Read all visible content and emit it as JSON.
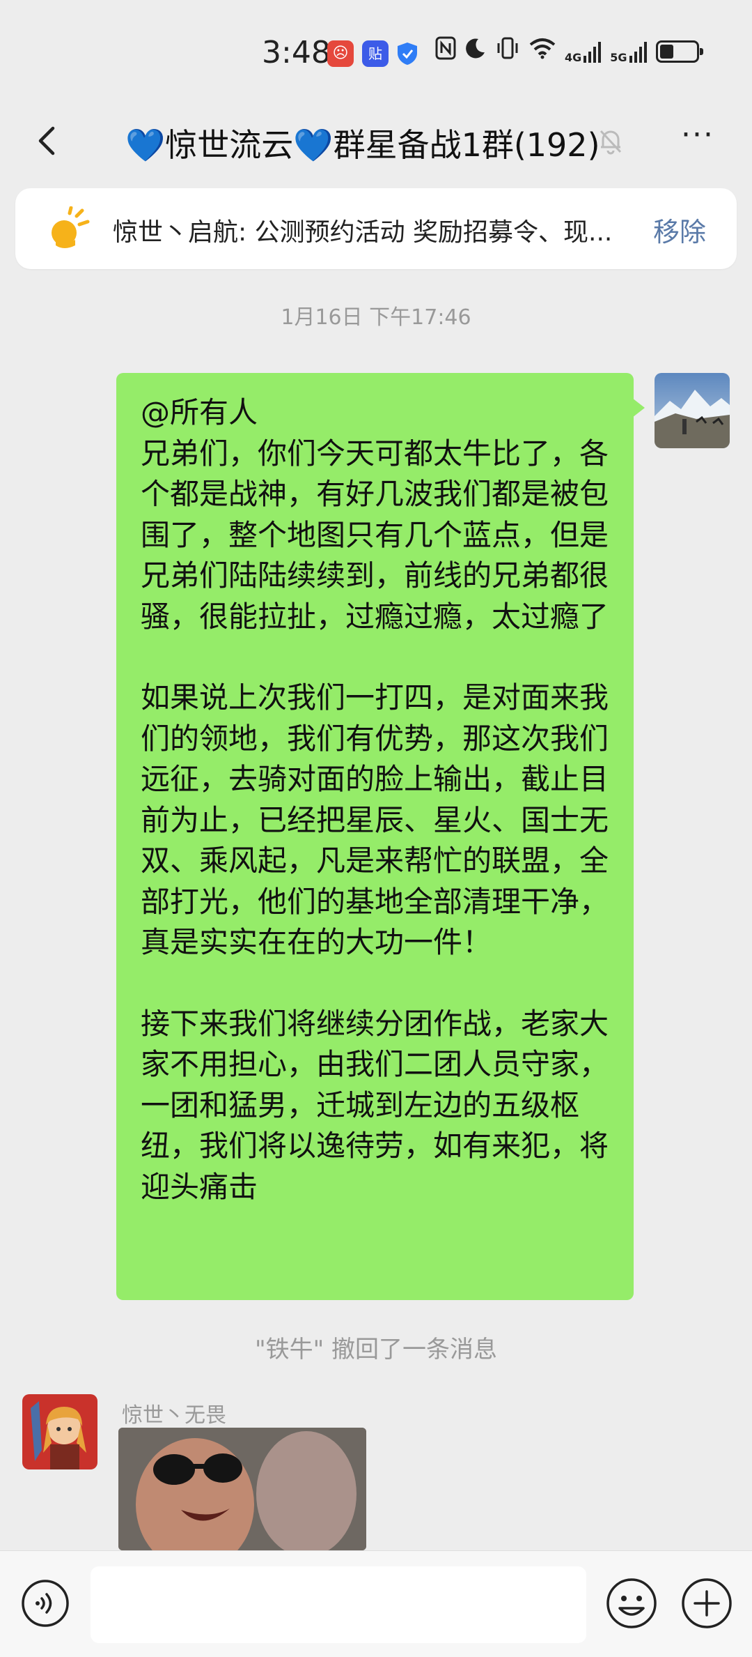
{
  "status_bar": {
    "time": "3:48",
    "app_badges": [
      "app-red-icon",
      "贴",
      "shield-icon"
    ],
    "network_4g": "4G",
    "network_5g": "5G"
  },
  "header": {
    "heart": "💙",
    "title_part1": "惊世流云",
    "title_part2": "群星备战1群(192)",
    "more": "···"
  },
  "pinned": {
    "text": "惊世丶启航: 公测预约活动 奖励招募令、现...",
    "remove_label": "移除"
  },
  "chat": {
    "timestamp": "1月16日 下午17:46",
    "my_message": {
      "p1": "@所有人\n兄弟们，你们今天可都太牛比了，各个都是战神，有好几波我们都是被包围了，整个地图只有几个蓝点，但是兄弟们陆陆续续到，前线的兄弟都很骚，很能拉扯，过瘾过瘾，太过瘾了",
      "p2": "如果说上次我们一打四，是对面来我们的领地，我们有优势，那这次我们远征，去骑对面的脸上输出，截止目前为止，已经把星辰、星火、国士无双、乘风起，凡是来帮忙的联盟，全部打光，他们的基地全部清理干净，真是实实在在的大功一件！",
      "p3": "接下来我们将继续分团作战，老家大家不用担心，由我们二团人员守家，一团和猛男，迁城到左边的五级枢纽，我们将以逸待劳，如有来犯，将迎头痛击"
    },
    "recall_notice": "\"铁牛\" 撤回了一条消息",
    "other_sender": "惊世丶无畏"
  },
  "colors": {
    "background": "#ededed",
    "my_bubble": "#95ec69",
    "link_blue": "#5a7aa8"
  }
}
